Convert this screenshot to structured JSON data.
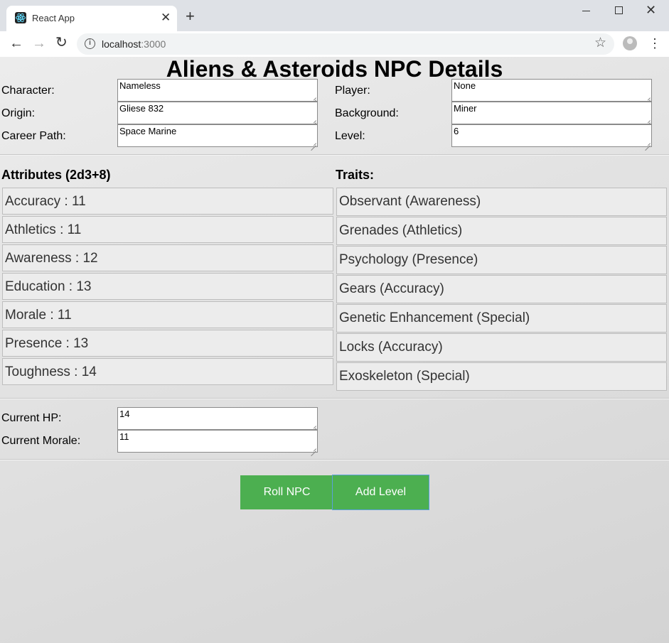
{
  "browser": {
    "tab_title": "React App",
    "url_host": "localhost",
    "url_port": ":3000"
  },
  "page": {
    "title": "Aliens & Asteroids NPC Details"
  },
  "details": {
    "character_label": "Character:",
    "character_value": "Nameless",
    "origin_label": "Origin:",
    "origin_value": "Gliese 832",
    "career_label": "Career Path:",
    "career_value": "Space Marine",
    "player_label": "Player:",
    "player_value": "None",
    "background_label": "Background:",
    "background_value": "Miner",
    "level_label": "Level:",
    "level_value": "6"
  },
  "attributes": {
    "heading": "Attributes (2d3+8)",
    "items": [
      "Accuracy : 11",
      "Athletics : 11",
      "Awareness : 12",
      "Education : 13",
      "Morale : 11",
      "Presence : 13",
      "Toughness : 14"
    ]
  },
  "traits": {
    "heading": "Traits:",
    "items": [
      "Observant (Awareness)",
      "Grenades (Athletics)",
      "Psychology (Presence)",
      "Gears (Accuracy)",
      "Genetic Enhancement (Special)",
      "Locks (Accuracy)",
      "Exoskeleton (Special)"
    ]
  },
  "status": {
    "hp_label": "Current HP:",
    "hp_value": "14",
    "morale_label": "Current Morale:",
    "morale_value": "11"
  },
  "actions": {
    "roll_label": "Roll NPC",
    "add_level_label": "Add Level"
  },
  "colors": {
    "button": "#4caf50"
  }
}
